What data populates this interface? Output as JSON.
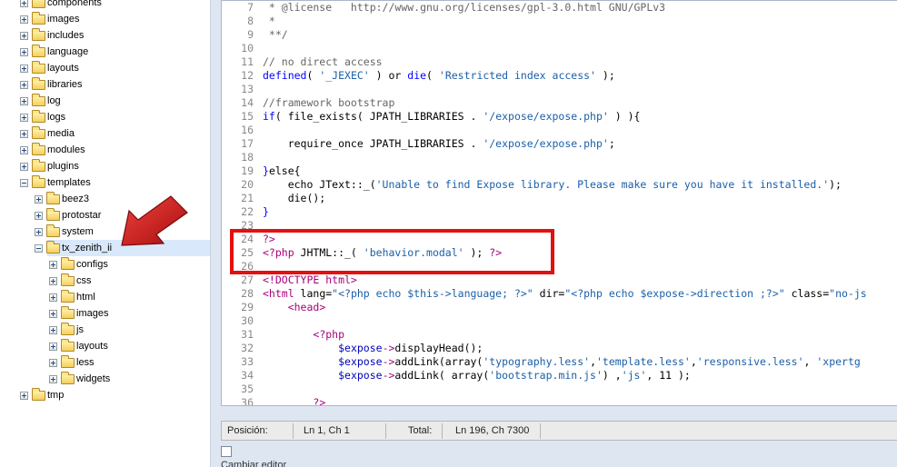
{
  "tree": {
    "nodes": [
      {
        "label": "components",
        "level": 0,
        "state": "plus"
      },
      {
        "label": "images",
        "level": 0,
        "state": "plus"
      },
      {
        "label": "includes",
        "level": 0,
        "state": "plus"
      },
      {
        "label": "language",
        "level": 0,
        "state": "plus"
      },
      {
        "label": "layouts",
        "level": 0,
        "state": "plus"
      },
      {
        "label": "libraries",
        "level": 0,
        "state": "plus"
      },
      {
        "label": "log",
        "level": 0,
        "state": "plus"
      },
      {
        "label": "logs",
        "level": 0,
        "state": "plus"
      },
      {
        "label": "media",
        "level": 0,
        "state": "plus"
      },
      {
        "label": "modules",
        "level": 0,
        "state": "plus"
      },
      {
        "label": "plugins",
        "level": 0,
        "state": "plus"
      },
      {
        "label": "templates",
        "level": 0,
        "state": "minus"
      },
      {
        "label": "beez3",
        "level": 1,
        "state": "plus"
      },
      {
        "label": "protostar",
        "level": 1,
        "state": "plus"
      },
      {
        "label": "system",
        "level": 1,
        "state": "plus"
      },
      {
        "label": "tx_zenith_ii",
        "level": 1,
        "state": "minus",
        "selected": true
      },
      {
        "label": "configs",
        "level": 2,
        "state": "plus"
      },
      {
        "label": "css",
        "level": 2,
        "state": "plus"
      },
      {
        "label": "html",
        "level": 2,
        "state": "plus"
      },
      {
        "label": "images",
        "level": 2,
        "state": "plus"
      },
      {
        "label": "js",
        "level": 2,
        "state": "plus"
      },
      {
        "label": "layouts",
        "level": 2,
        "state": "plus"
      },
      {
        "label": "less",
        "level": 2,
        "state": "plus"
      },
      {
        "label": "widgets",
        "level": 2,
        "state": "plus"
      },
      {
        "label": "tmp",
        "level": 0,
        "state": "plus"
      }
    ]
  },
  "editor": {
    "lines": [
      {
        "n": "7",
        "segs": [
          [
            " * @license   http://www.gnu.org/licenses/gpl-3.0.html GNU/GPLv3",
            "c-com"
          ]
        ]
      },
      {
        "n": "8",
        "segs": [
          [
            " *",
            "c-com"
          ]
        ]
      },
      {
        "n": "9",
        "segs": [
          [
            " **/",
            "c-com"
          ]
        ]
      },
      {
        "n": "10",
        "segs": []
      },
      {
        "n": "11",
        "segs": [
          [
            "// no direct access",
            "c-com"
          ]
        ]
      },
      {
        "n": "12",
        "segs": [
          [
            "defined",
            "c-blue"
          ],
          [
            "( ",
            ""
          ],
          [
            "'_JEXEC'",
            "c-str"
          ],
          [
            " ) or ",
            ""
          ],
          [
            "die",
            "c-blue"
          ],
          [
            "( ",
            ""
          ],
          [
            "'Restricted index access'",
            "c-str"
          ],
          [
            " );",
            ""
          ]
        ]
      },
      {
        "n": "13",
        "segs": []
      },
      {
        "n": "14",
        "segs": [
          [
            "//framework bootstrap",
            "c-com"
          ]
        ]
      },
      {
        "n": "15",
        "segs": [
          [
            "if",
            "c-blue"
          ],
          [
            "( file_exists( JPATH_LIBRARIES . ",
            ""
          ],
          [
            "'/expose/expose.php'",
            "c-str"
          ],
          [
            " ) ){",
            ""
          ]
        ]
      },
      {
        "n": "16",
        "segs": []
      },
      {
        "n": "17",
        "segs": [
          [
            "    require_once JPATH_LIBRARIES . ",
            ""
          ],
          [
            "'/expose/expose.php'",
            "c-str"
          ],
          [
            ";",
            ""
          ]
        ]
      },
      {
        "n": "18",
        "segs": []
      },
      {
        "n": "19",
        "segs": [
          [
            "}",
            "c-blue"
          ],
          [
            "else{",
            ""
          ]
        ]
      },
      {
        "n": "20",
        "segs": [
          [
            "    echo JText::_(",
            ""
          ],
          [
            "'Unable to find Expose library. Please make sure you have it installed.'",
            "c-str"
          ],
          [
            ");",
            ""
          ]
        ]
      },
      {
        "n": "21",
        "segs": [
          [
            "    die();",
            ""
          ]
        ]
      },
      {
        "n": "22",
        "segs": [
          [
            "}",
            "c-blue"
          ]
        ]
      },
      {
        "n": "23",
        "segs": []
      },
      {
        "n": "24",
        "segs": [
          [
            "?>",
            "c-tag"
          ]
        ]
      },
      {
        "n": "25",
        "segs": [
          [
            "<?php",
            "c-tag"
          ],
          [
            " JHTML::_( ",
            ""
          ],
          [
            "'behavior.modal'",
            "c-str"
          ],
          [
            " ); ",
            ""
          ],
          [
            "?>",
            "c-tag"
          ]
        ]
      },
      {
        "n": "26",
        "segs": []
      },
      {
        "n": "27",
        "segs": [
          [
            "<!DOCTYPE html>",
            "c-tag"
          ]
        ]
      },
      {
        "n": "28",
        "segs": [
          [
            "<html ",
            "c-tag"
          ],
          [
            "lang=",
            ""
          ],
          [
            "\"<?php echo $this->language; ?>\"",
            "c-str"
          ],
          [
            " dir=",
            ""
          ],
          [
            "\"<?php echo $expose->direction ;?>\"",
            "c-str"
          ],
          [
            " class=",
            ""
          ],
          [
            "\"no-js",
            "c-str"
          ]
        ]
      },
      {
        "n": "29",
        "segs": [
          [
            "    ",
            ""
          ],
          [
            "<head>",
            "c-tag"
          ]
        ]
      },
      {
        "n": "30",
        "segs": []
      },
      {
        "n": "31",
        "segs": [
          [
            "        ",
            ""
          ],
          [
            "<?php",
            "c-tag"
          ]
        ]
      },
      {
        "n": "32",
        "segs": [
          [
            "            ",
            ""
          ],
          [
            "$expose",
            "c-var"
          ],
          [
            "->",
            "c-tag"
          ],
          [
            "displayHead();",
            ""
          ]
        ]
      },
      {
        "n": "33",
        "segs": [
          [
            "            ",
            ""
          ],
          [
            "$expose",
            "c-var"
          ],
          [
            "->",
            "c-tag"
          ],
          [
            "addLink(array(",
            ""
          ],
          [
            "'typography.less'",
            "c-str"
          ],
          [
            ",",
            ""
          ],
          [
            "'template.less'",
            "c-str"
          ],
          [
            ",",
            ""
          ],
          [
            "'responsive.less'",
            "c-str"
          ],
          [
            ", ",
            ""
          ],
          [
            "'xpertg",
            "c-str"
          ]
        ]
      },
      {
        "n": "34",
        "segs": [
          [
            "            ",
            ""
          ],
          [
            "$expose",
            "c-var"
          ],
          [
            "->",
            "c-tag"
          ],
          [
            "addLink( array(",
            ""
          ],
          [
            "'bootstrap.min.js'",
            "c-str"
          ],
          [
            ") ,",
            ""
          ],
          [
            "'js'",
            "c-str"
          ],
          [
            ", 11 );",
            ""
          ]
        ]
      },
      {
        "n": "35",
        "segs": []
      },
      {
        "n": "36",
        "segs": [
          [
            "        ",
            ""
          ],
          [
            "?>",
            "c-tag"
          ]
        ]
      }
    ]
  },
  "statusbar": {
    "position_label": "Posición:",
    "position_value": "Ln 1, Ch 1",
    "total_label": "Total:",
    "total_value": "Ln 196, Ch 7300"
  },
  "toggle": {
    "label": "Cambiar editor"
  },
  "colors": {
    "highlight_box": "#e41010",
    "arrow": "#c81414",
    "selection": "#d9e8fb"
  }
}
